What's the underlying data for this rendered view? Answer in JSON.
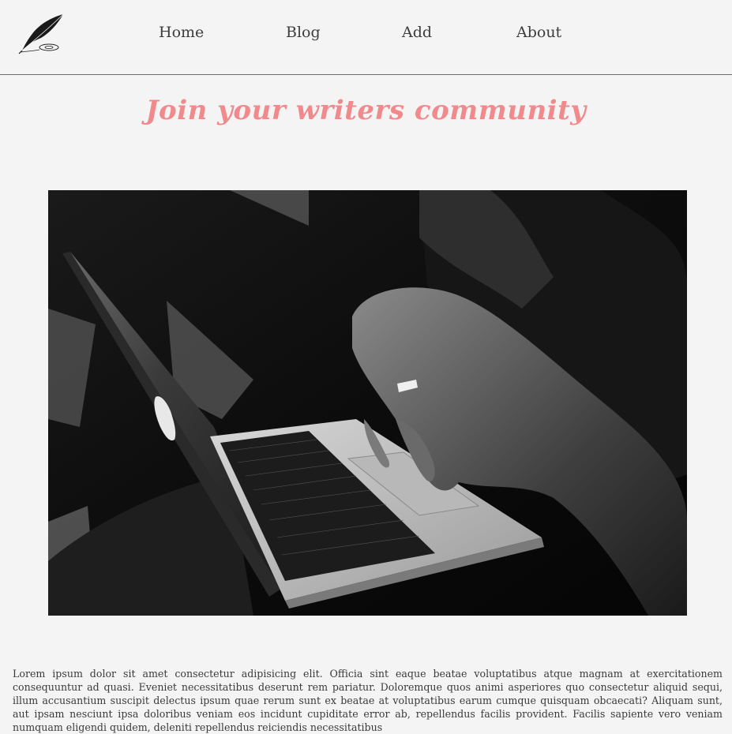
{
  "nav": {
    "logo_icon": "quill-pen-icon",
    "items": [
      {
        "label": "Home"
      },
      {
        "label": "Blog"
      },
      {
        "label": "Add"
      },
      {
        "label": "About"
      }
    ]
  },
  "hero": {
    "title": "Join your writers community",
    "image_icon": "laptop-photo"
  },
  "content": {
    "paragraph": "Lorem ipsum dolor sit amet consectetur adipisicing elit. Officia sint eaque beatae voluptatibus atque magnam at exercitationem consequuntur ad quasi. Eveniet necessitatibus deserunt rem pariatur. Doloremque quos animi asperiores quo consectetur aliquid sequi, illum accusantium suscipit delectus ipsum quae rerum sunt ex beatae at voluptatibus earum cumque quisquam obcaecati? Aliquam sunt, aut ipsam nesciunt ipsa doloribus veniam eos incidunt cupiditate error ab, repellendus facilis provident. Facilis sapiente vero veniam numquam eligendi quidem, deleniti repellendus reiciendis necessitatibus"
  },
  "colors": {
    "background": "#f4f4f4",
    "accent_title": "#f08a8c",
    "text": "#3a3a3a",
    "divider": "#6b6b6b"
  }
}
